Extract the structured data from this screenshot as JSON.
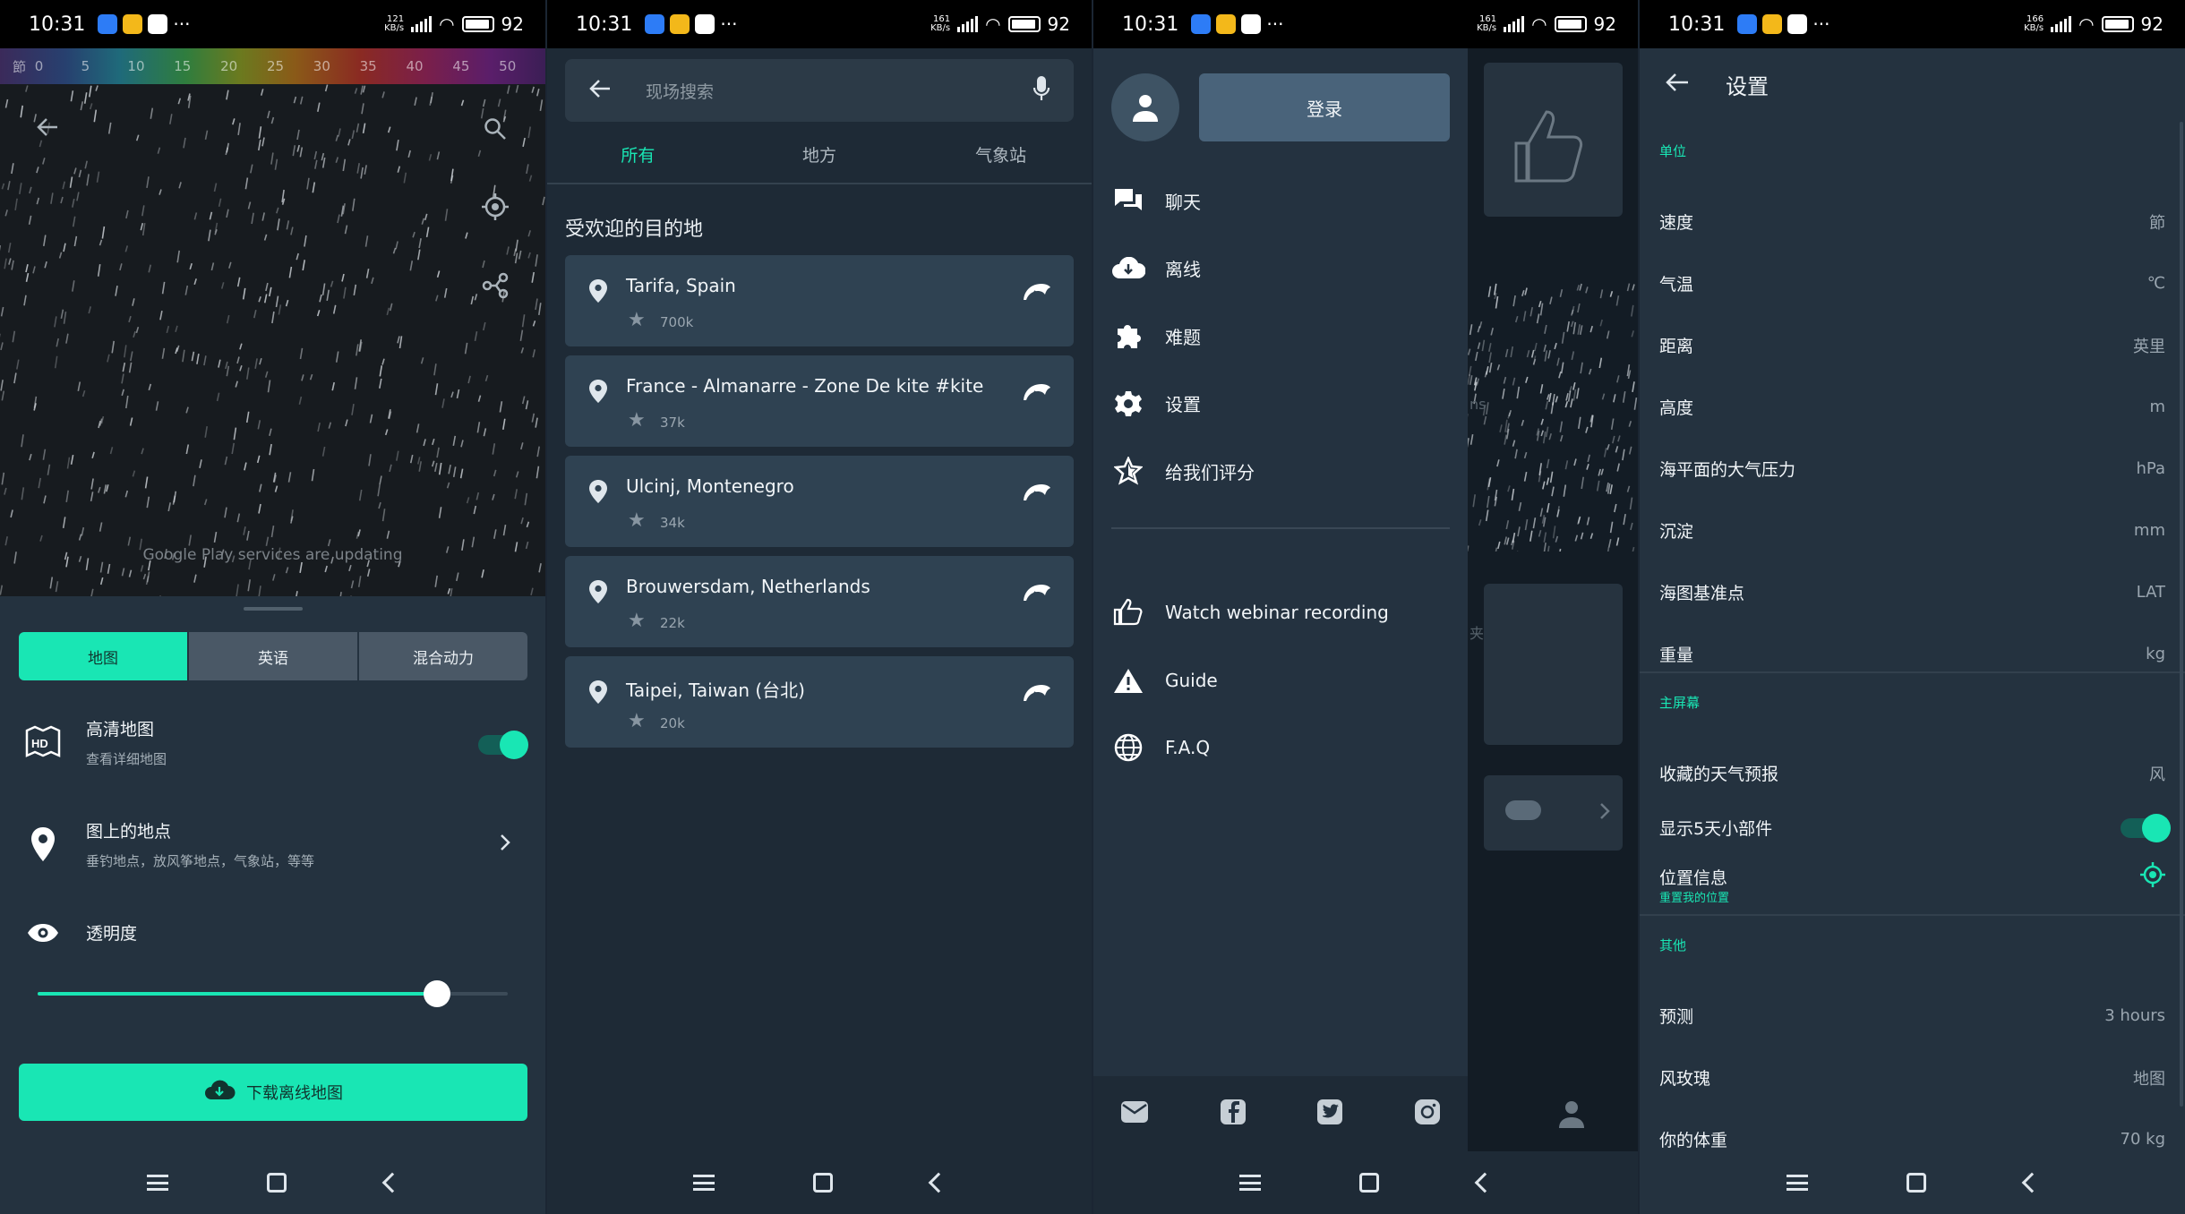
{
  "status_bar": {
    "time": "10:31",
    "battery": "92",
    "speeds": [
      "121",
      "161",
      "161",
      "166"
    ],
    "speed_unit": "KB/s"
  },
  "map_panel": {
    "scale_unit": "節",
    "scale_values": [
      "0",
      "5",
      "10",
      "15",
      "20",
      "25",
      "30",
      "35",
      "40",
      "45",
      "50"
    ],
    "map_notice": "Google Play services are updating",
    "segments": [
      "地图",
      "英语",
      "混合动力"
    ],
    "active_segment": 0,
    "hd_map": {
      "title": "高清地图",
      "subtitle": "查看详细地图",
      "enabled": true
    },
    "places": {
      "title": "图上的地点",
      "subtitle": "垂钓地点，放风筝地点，气象站，等等"
    },
    "opacity": {
      "title": "透明度",
      "value": 0.85
    },
    "download_label": "下载离线地图"
  },
  "search_panel": {
    "search_placeholder": "现场搜索",
    "tabs": [
      "所有",
      "地方",
      "气象站"
    ],
    "active_tab": 0,
    "section_title": "受欢迎的目的地",
    "spots": [
      {
        "name": "Tarifa, Spain",
        "count": "700k"
      },
      {
        "name": "France - Almanarre - Zone De kite #kite",
        "count": "37k"
      },
      {
        "name": "Ulcinj, Montenegro",
        "count": "34k"
      },
      {
        "name": "Brouwersdam, Netherlands",
        "count": "22k"
      },
      {
        "name": "Taipei, Taiwan (台北)",
        "count": "20k"
      }
    ]
  },
  "drawer_panel": {
    "login_label": "登录",
    "menu": [
      {
        "label": "聊天",
        "icon": "chat-icon"
      },
      {
        "label": "离线",
        "icon": "cloud-download-icon"
      },
      {
        "label": "难题",
        "icon": "puzzle-icon"
      },
      {
        "label": "设置",
        "icon": "gear-icon"
      },
      {
        "label": "给我们评分",
        "icon": "star-rate-icon"
      }
    ],
    "menu2": [
      {
        "label": "Watch webinar recording",
        "icon": "thumbs-up-icon"
      },
      {
        "label": "Guide",
        "icon": "warning-icon"
      },
      {
        "label": "F.A.Q",
        "icon": "globe-icon"
      }
    ],
    "social": [
      "mail-icon",
      "facebook-icon",
      "twitter-icon",
      "instagram-icon"
    ],
    "behind_fragments": [
      "ns",
      "夹"
    ]
  },
  "settings_panel": {
    "title": "设置",
    "sections": [
      {
        "title": "单位",
        "rows": [
          {
            "label": "速度",
            "value": "節"
          },
          {
            "label": "气温",
            "value": "℃"
          },
          {
            "label": "距离",
            "value": "英里"
          },
          {
            "label": "高度",
            "value": "m"
          },
          {
            "label": "海平面的大气压力",
            "value": "hPa"
          },
          {
            "label": "沉淀",
            "value": "mm"
          },
          {
            "label": "海图基准点",
            "value": "LAT"
          },
          {
            "label": "重量",
            "value": "kg"
          }
        ]
      },
      {
        "title": "主屏幕",
        "rows": [
          {
            "label": "收藏的天气预报",
            "value": "风"
          },
          {
            "label": "显示5天小部件",
            "value": ""
          },
          {
            "label": "位置信息",
            "value": ""
          }
        ]
      },
      {
        "title": "其他",
        "rows": [
          {
            "label": "预测",
            "value": "3 hours"
          },
          {
            "label": "风玫瑰",
            "value": "地图"
          },
          {
            "label": "你的体重",
            "value": "70 kg"
          }
        ]
      }
    ],
    "reset_location": "重置我的位置",
    "show_5day_widget": true
  },
  "colors": {
    "accent": "#19e6b4",
    "panel": "#24323f",
    "card": "#2f4252",
    "map": "#171b1f"
  }
}
